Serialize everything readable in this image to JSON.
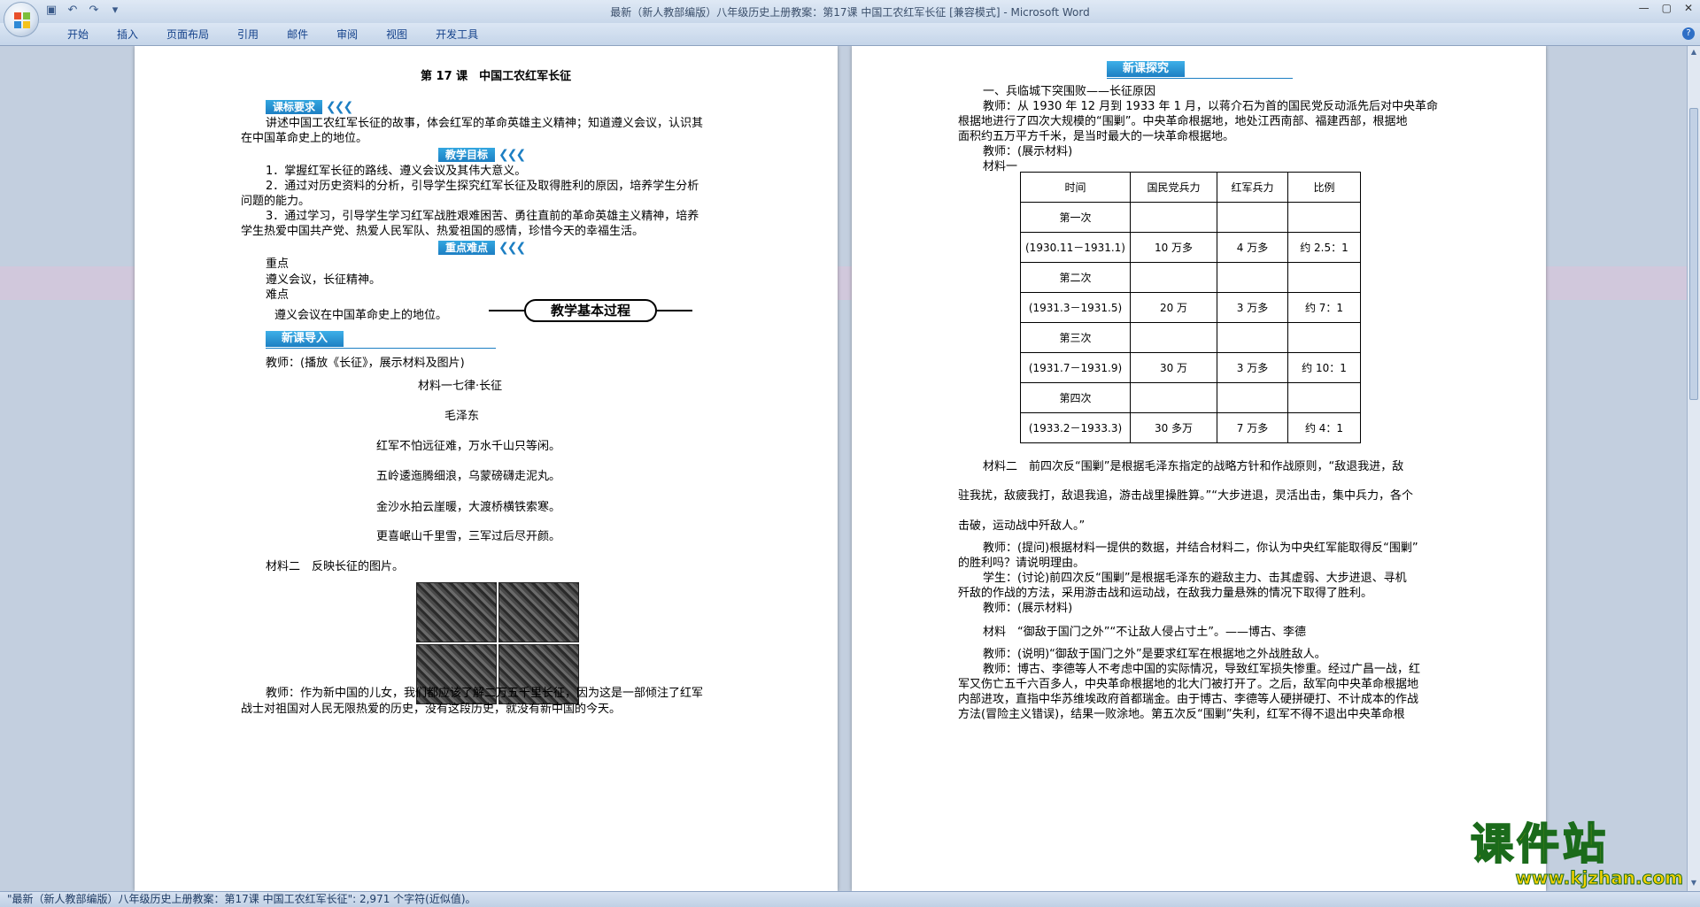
{
  "window": {
    "title": "最新（新人教部编版）八年级历史上册教案：第17课 中国工农红军长征 [兼容模式] - Microsoft Word"
  },
  "ribbon": {
    "tabs": [
      "开始",
      "插入",
      "页面布局",
      "引用",
      "邮件",
      "审阅",
      "视图",
      "开发工具"
    ]
  },
  "left_page": {
    "title": "第 17 课　中国工农红军长征",
    "hdr_kbyq": "课标要求",
    "kbyq_line1": "讲述中国工农红军长征的故事，体会红军的革命英雄主义精神；知道遵义会议，认识其",
    "kbyq_line2": "在中国革命史上的地位。",
    "hdr_jxmb": "教学目标",
    "goal1": "1．掌握红军长征的路线、遵义会议及其伟大意义。",
    "goal2_line1": "2．通过对历史资料的分析，引导学生探究红军长征及取得胜利的原因，培养学生分析",
    "goal2_line2": "问题的能力。",
    "goal3_line1": "3．通过学习，引导学生学习红军战胜艰难困苦、勇往直前的革命英雄主义精神，培养",
    "goal3_line2": "学生热爱中国共产党、热爱人民军队、热爱祖国的感情，珍惜今天的幸福生活。",
    "hdr_zdnd": "重点难点",
    "zd_label": "重点",
    "zd_text": "遵义会议，长征精神。",
    "nd_label": "难点",
    "nd_text": "遵义会议在中国革命史上的地位。",
    "banner": "教学基本过程",
    "hdr_xkdr": "新课导入",
    "intro": "教师：(播放《长征》，展示材料及图片)",
    "poem_title": "材料一七律·长征",
    "poem_author": "毛泽东",
    "poem1": "红军不怕远征难，万水千山只等闲。",
    "poem2": "五岭逶迤腾细浪，乌蒙磅礴走泥丸。",
    "poem3": "金沙水拍云崖暖，大渡桥横铁索寒。",
    "poem4": "更喜岷山千里雪，三军过后尽开颜。",
    "mat2": "材料二　反映长征的图片。",
    "closing1": "教师：作为新中国的儿女，我们都应该了解二万五千里长征，因为这是一部倾注了红军",
    "closing2": "战士对祖国对人民无限热爱的历史，没有这段历史，就没有新中国的今天。"
  },
  "right_page": {
    "hdr_xktj": "新课探究",
    "sec1": "一、兵临城下突围败——长征原因",
    "p1_l1": "教师：从 1930 年 12 月到 1933 年 1 月，以蒋介石为首的国民党反动派先后对中央革命",
    "p1_l2": "根据地进行了四次大规模的“围剿”。中央革命根据地，地处江西南部、福建西部，根据地",
    "p1_l3": "面积约五万平方千米，是当时最大的一块革命根据地。",
    "p2": "教师：(展示材料)",
    "mat1": "材料一",
    "table": {
      "header": [
        "时间",
        "国民党兵力",
        "红军兵力",
        "比例"
      ],
      "rows": [
        [
          "第一次",
          "",
          "",
          ""
        ],
        [
          "(1930.11－1931.1)",
          "10 万多",
          "4 万多",
          "约 2.5：1"
        ],
        [
          "第二次",
          "",
          "",
          ""
        ],
        [
          "(1931.3－1931.5)",
          "20 万",
          "3 万多",
          "约 7：1"
        ],
        [
          "第三次",
          "",
          "",
          ""
        ],
        [
          "(1931.7－1931.9)",
          "30 万",
          "3 万多",
          "约 10：1"
        ],
        [
          "第四次",
          "",
          "",
          ""
        ],
        [
          "(1933.2－1933.3)",
          "30 多万",
          "7 万多",
          "约 4：1"
        ]
      ]
    },
    "mat2_l1": "材料二　前四次反“围剿”是根据毛泽东指定的战略方针和作战原则，“敌退我进，敌",
    "mat2_l2": "驻我扰，敌疲我打，敌退我追，游击战里操胜算。”“大步进退，灵活出击，集中兵力，各个",
    "mat2_l3": "击破，运动战中歼敌人。”",
    "q_l1": "教师：(提问)根据材料一提供的数据，并结合材料二，你认为中央红军能取得反“围剿”",
    "q_l2": "的胜利吗？请说明理由。",
    "s_l1": "学生：(讨论)前四次反“围剿”是根据毛泽东的避敌主力、击其虚弱、大步进退、寻机",
    "s_l2": "歼敌的作战的方法，采用游击战和运动战，在敌我力量悬殊的情况下取得了胜利。",
    "p3": "教师：(展示材料)",
    "mat3": "材料　“御敌于国门之外”“不让敌人侵占寸土”。——博古、李德",
    "p4": "教师：(说明)“御敌于国门之外”是要求红军在根据地之外战胜敌人。",
    "p5_l1": "教师：博古、李德等人不考虑中国的实际情况，导致红军损失惨重。经过广昌一战，红",
    "p5_l2": "军又伤亡五千六百多人，中央革命根据地的北大门被打开了。之后，敌军向中央革命根据地",
    "p5_l3": "内部进攻，直指中华苏维埃政府首都瑞金。由于博古、李德等人硬拼硬打、不计成本的作战",
    "p5_l4": "方法(冒险主义错误)，结果一败涂地。第五次反“围剿”失利，红军不得不退出中央革命根"
  },
  "statusbar": {
    "text": "\"最新（新人教部编版）八年级历史上册教案：第17课 中国工农红军长征\": 2,971 个字符(近似值)。"
  },
  "watermark": {
    "text": "课件站",
    "url": "www.kjzhan.com"
  },
  "colors": {
    "accent": "#1d7fc3",
    "ribbon": "#c5d5e9",
    "watermark": "#f6d200"
  }
}
